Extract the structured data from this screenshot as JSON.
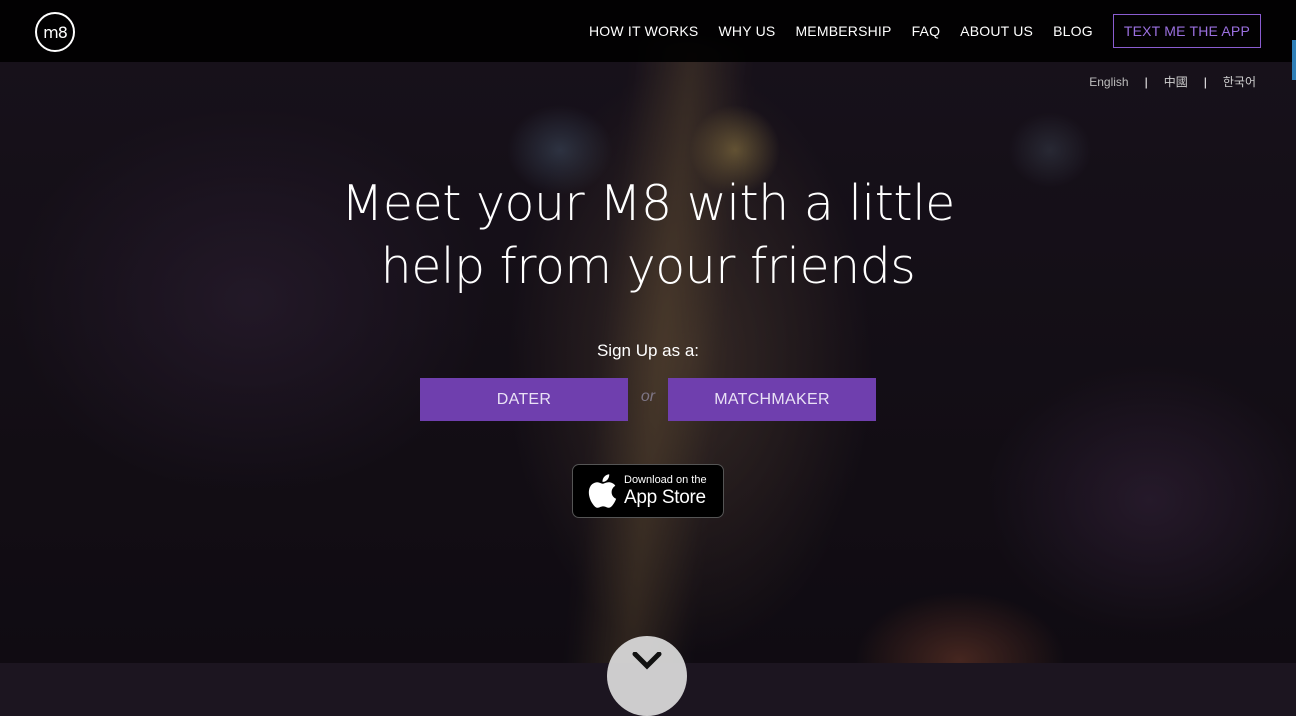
{
  "brand": {
    "logo_text": "m8"
  },
  "nav": {
    "items": [
      "HOW IT WORKS",
      "WHY US",
      "MEMBERSHIP",
      "FAQ",
      "ABOUT US",
      "BLOG"
    ],
    "cta": "TEXT ME THE APP"
  },
  "languages": {
    "options": [
      "English",
      "中國",
      "한국어"
    ],
    "separator": "|"
  },
  "hero": {
    "title_line1": "Meet your M8 with a little",
    "title_line2": "help from your friends",
    "signup_label": "Sign Up as a:",
    "dater_button": "DATER",
    "or_text": "or",
    "matchmaker_button": "MATCHMAKER"
  },
  "app_store": {
    "small_text": "Download on the",
    "big_text": "App Store",
    "icon": "apple-icon"
  },
  "scroll": {
    "icon": "chevron-down-icon"
  },
  "colors": {
    "accent": "#6f3fae",
    "cta_border": "#8a5cd0",
    "header_bg": "#000000"
  }
}
